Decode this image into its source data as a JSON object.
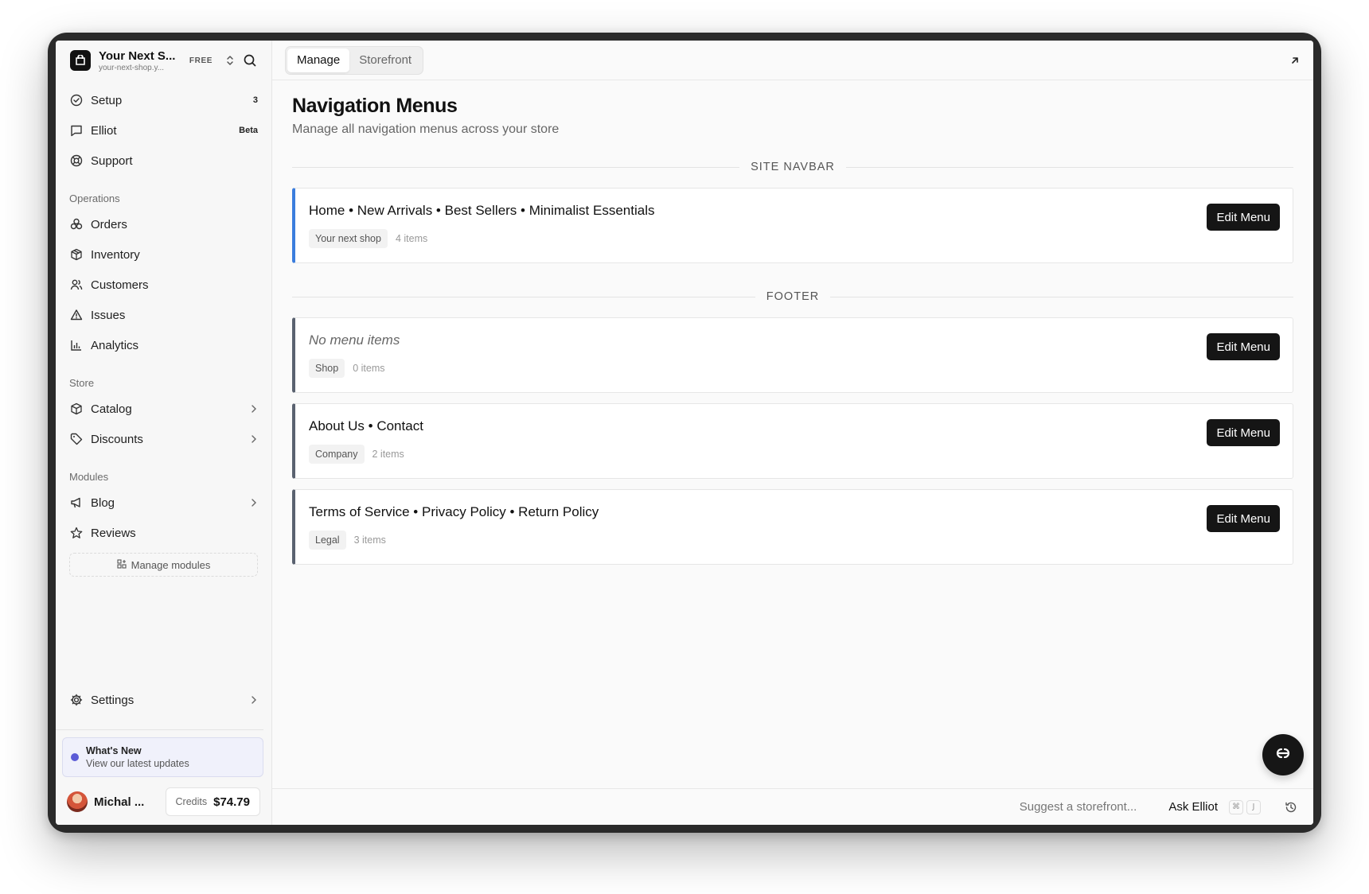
{
  "shop": {
    "name": "Your Next S...",
    "url": "your-next-shop.y...",
    "plan": "FREE"
  },
  "sidebar": {
    "top_items": [
      {
        "label": "Setup",
        "badge": "3"
      },
      {
        "label": "Elliot",
        "badge": "Beta"
      },
      {
        "label": "Support"
      }
    ],
    "operations_label": "Operations",
    "operations": [
      {
        "label": "Orders"
      },
      {
        "label": "Inventory"
      },
      {
        "label": "Customers"
      },
      {
        "label": "Issues"
      },
      {
        "label": "Analytics"
      }
    ],
    "store_label": "Store",
    "store": [
      {
        "label": "Catalog"
      },
      {
        "label": "Discounts"
      }
    ],
    "modules_label": "Modules",
    "modules": [
      {
        "label": "Blog"
      },
      {
        "label": "Reviews"
      }
    ],
    "manage_modules": "Manage modules",
    "settings": "Settings",
    "whats_new": {
      "title": "What's New",
      "subtitle": "View our latest updates"
    },
    "user": {
      "name": "Michal ...",
      "credits_label": "Credits",
      "credits_value": "$74.79"
    }
  },
  "topbar": {
    "tabs": [
      {
        "label": "Manage",
        "active": true
      },
      {
        "label": "Storefront",
        "active": false
      }
    ]
  },
  "page": {
    "title": "Navigation Menus",
    "subtitle": "Manage all navigation menus across your store"
  },
  "groups": [
    {
      "heading": "SITE NAVBAR",
      "menus": [
        {
          "title": "Home • New Arrivals • Best Sellers • Minimalist Essentials",
          "tag": "Your next shop",
          "count": "4 items",
          "button": "Edit Menu"
        }
      ]
    },
    {
      "heading": "FOOTER",
      "menus": [
        {
          "title": "No menu items",
          "tag": "Shop",
          "count": "0 items",
          "button": "Edit Menu"
        },
        {
          "title": "About Us • Contact",
          "tag": "Company",
          "count": "2 items",
          "button": "Edit Menu"
        },
        {
          "title": "Terms of Service • Privacy Policy • Return Policy",
          "tag": "Legal",
          "count": "3 items",
          "button": "Edit Menu"
        }
      ]
    }
  ],
  "bottombar": {
    "suggest_placeholder": "Suggest a storefront...",
    "ask_label": "Ask Elliot",
    "kbd_1": "⌘",
    "kbd_2": "J"
  },
  "colors": {
    "accent_blue": "#3b7ddd",
    "card_border": "#5a6270",
    "button_dark": "#151515",
    "whats_new_dot": "#5b5bd6"
  },
  "icons": {
    "shop_logo": "shop-bag-icon",
    "switch": "chevron-up-down-icon",
    "search": "search-icon",
    "expand": "arrow-up-right-icon",
    "history": "history-icon",
    "fab": "elliot-assistant-icon"
  }
}
